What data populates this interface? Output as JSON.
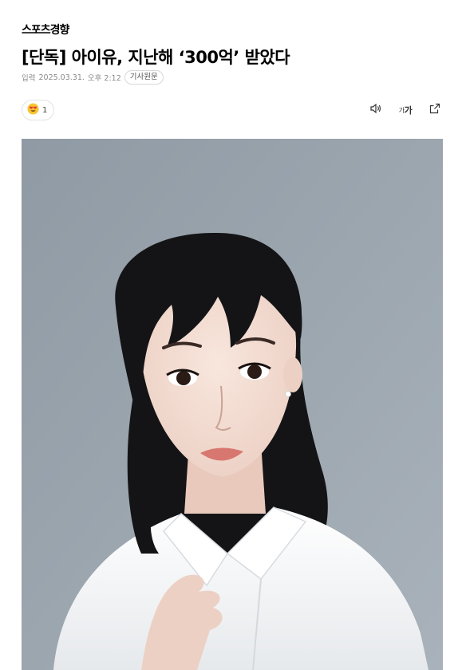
{
  "press": {
    "name": "스포츠경향"
  },
  "article": {
    "title": "[단독] 아이유, 지난해 ‘300억’ 받았다",
    "input_label": "입력",
    "date": "2025.03.31.",
    "time": "오후 2:12",
    "source_button": "기사원문"
  },
  "reaction": {
    "emoji": "heart-eyes-emoji",
    "count": "1"
  },
  "toolbar": {
    "tts_icon": "speaker-icon",
    "font_small": "가",
    "font_large": "가",
    "share_icon": "share-icon"
  },
  "photo": {
    "subject": "portrait-photo",
    "colors": {
      "background": "#9aa4ad",
      "hair": "#141416",
      "shirt": "#f3f4f6",
      "skin": "#f1d9cf",
      "lips": "#d8776f"
    }
  }
}
